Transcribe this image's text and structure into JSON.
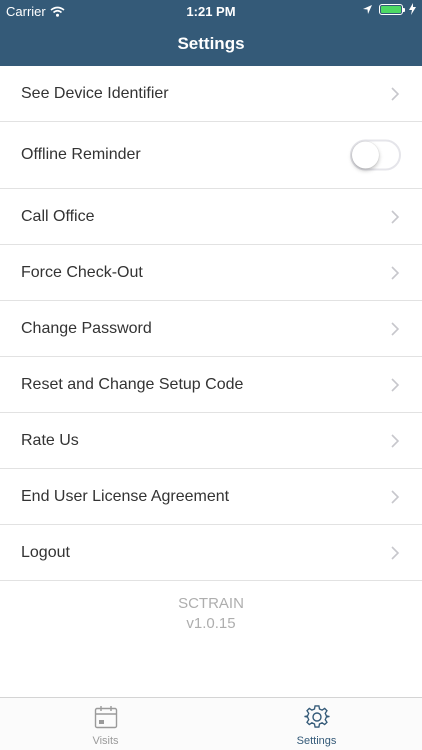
{
  "status_bar": {
    "carrier": "Carrier",
    "time": "1:21 PM"
  },
  "nav": {
    "title": "Settings"
  },
  "settings": {
    "items": [
      {
        "label": "See Device Identifier"
      },
      {
        "label": "Offline Reminder",
        "toggle_on": false
      },
      {
        "label": "Call Office"
      },
      {
        "label": "Force Check-Out"
      },
      {
        "label": "Change Password"
      },
      {
        "label": "Reset and Change Setup Code"
      },
      {
        "label": "Rate Us"
      },
      {
        "label": "End User License Agreement"
      },
      {
        "label": "Logout"
      }
    ]
  },
  "footer": {
    "app_name": "SCTRAIN",
    "version": "v1.0.15"
  },
  "tabbar": {
    "tabs": [
      {
        "label": "Visits",
        "icon": "calendar-icon",
        "active": false
      },
      {
        "label": "Settings",
        "icon": "gear-icon",
        "active": true
      }
    ]
  },
  "colors": {
    "header": "#345a78",
    "active_tab": "#345a78",
    "inactive_tab": "#9a9a9a",
    "battery": "#4cd964"
  }
}
